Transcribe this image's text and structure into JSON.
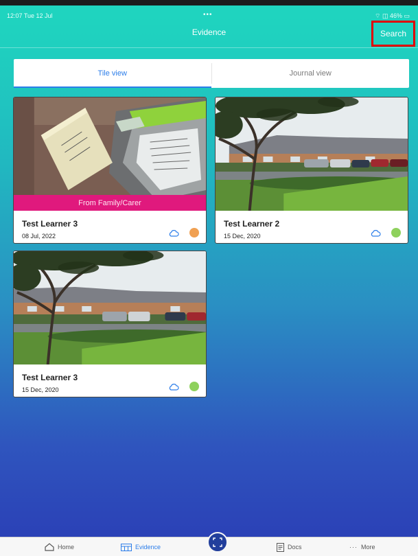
{
  "status_bar": {
    "time": "12:07  Tue 12 Jul",
    "center": "•••",
    "battery": "⌔ ◫ 46% ▭"
  },
  "nav": {
    "title": "Evidence",
    "search_label": "Search"
  },
  "segments": [
    {
      "label": "Tile view",
      "active": true
    },
    {
      "label": "Journal view",
      "active": false
    }
  ],
  "cards": [
    {
      "name": "Test Learner 3",
      "date": "08 Jul, 2022",
      "banner": "From Family/Carer",
      "photo": "notebook-on-desk",
      "status_color": "#f0a052",
      "cloud_icon": "cloud-icon"
    },
    {
      "name": "Test Learner 2",
      "date": "15 Dec, 2020",
      "photo": "school-building-with-tree",
      "status_color": "#8ed15c",
      "cloud_icon": "cloud-icon"
    },
    {
      "name": "Test Learner 3",
      "date": "15 Dec, 2020",
      "photo": "school-building-with-tree",
      "status_color": "#8ed15c",
      "cloud_icon": "cloud-icon"
    }
  ],
  "tabbar": {
    "home": "Home",
    "evidence": "Evidence",
    "docs": "Docs",
    "more": "More",
    "center_icon": "scan-icon"
  },
  "colors": {
    "accent": "#2b7de9",
    "banner": "#e0197d",
    "search_highlight": "#e00000"
  }
}
